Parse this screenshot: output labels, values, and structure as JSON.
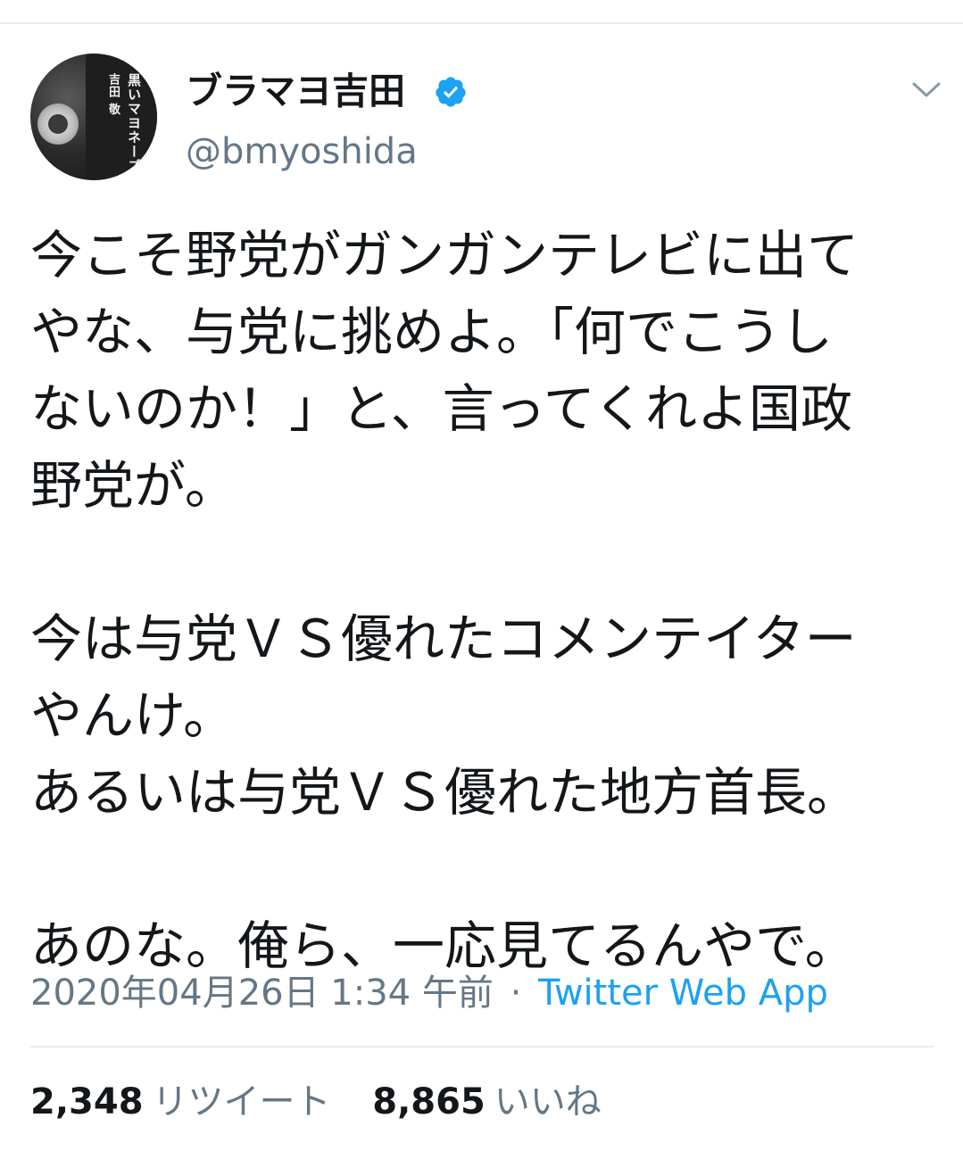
{
  "tweet": {
    "author": {
      "display_name": "ブラマヨ吉田",
      "username": "@bmyoshida",
      "verified": true,
      "avatar_text": {
        "title": "黒いマヨネーズ",
        "author": "吉田 敬"
      }
    },
    "text": "今こそ野党がガンガンテレビに出て\nやな、与党に挑めよ。「何でこうし\nないのか！」と、言ってくれよ国政\n野党が。\n\n今は与党ＶＳ優れたコメンテイター\nやんけ。\nあるいは与党ＶＳ優れた地方首長。\n\nあのな。俺ら、一応見てるんやで。",
    "timestamp": "2020年04月26日 1:34 午前",
    "separator": "·",
    "source": "Twitter Web App",
    "stats": {
      "retweets": {
        "count": "2,348",
        "label": "リツイート"
      },
      "likes": {
        "count": "8,865",
        "label": "いいね"
      }
    }
  },
  "icons": {
    "verified": "verified-badge-icon",
    "menu": "chevron-down-icon"
  },
  "colors": {
    "text": "#14171a",
    "secondary": "#657786",
    "link": "#1da1f2",
    "verified": "#1da1f2",
    "divider": "#e6ecf0"
  }
}
